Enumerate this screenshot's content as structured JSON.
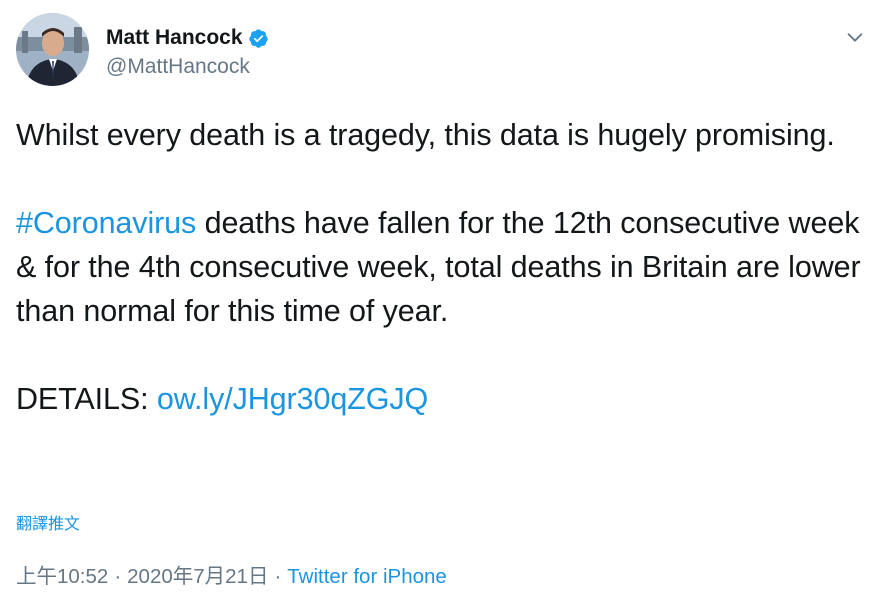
{
  "author": {
    "display_name": "Matt Hancock",
    "handle": "@MattHancock",
    "verified": true
  },
  "icons": {
    "verified": "verified-badge-icon",
    "caret": "chevron-down-icon"
  },
  "tweet": {
    "line1": "Whilst every death is a tragedy, this data is hugely promising.",
    "hashtag": "#Coronavirus",
    "line2_rest": " deaths have fallen for the 12th consecutive week & for the 4th consecutive week, total deaths in Britain are lower than normal for this time of year.",
    "details_label": "DETAILS: ",
    "details_link": "ow.ly/JHgr30qZGJQ"
  },
  "translate_label": "翻譯推文",
  "meta": {
    "time": "上午10:52",
    "separator": "·",
    "date": "2020年7月21日",
    "source": "Twitter for iPhone"
  },
  "colors": {
    "link": "#1b95e0",
    "secondary_text": "#657786",
    "primary_text": "#14171a"
  }
}
